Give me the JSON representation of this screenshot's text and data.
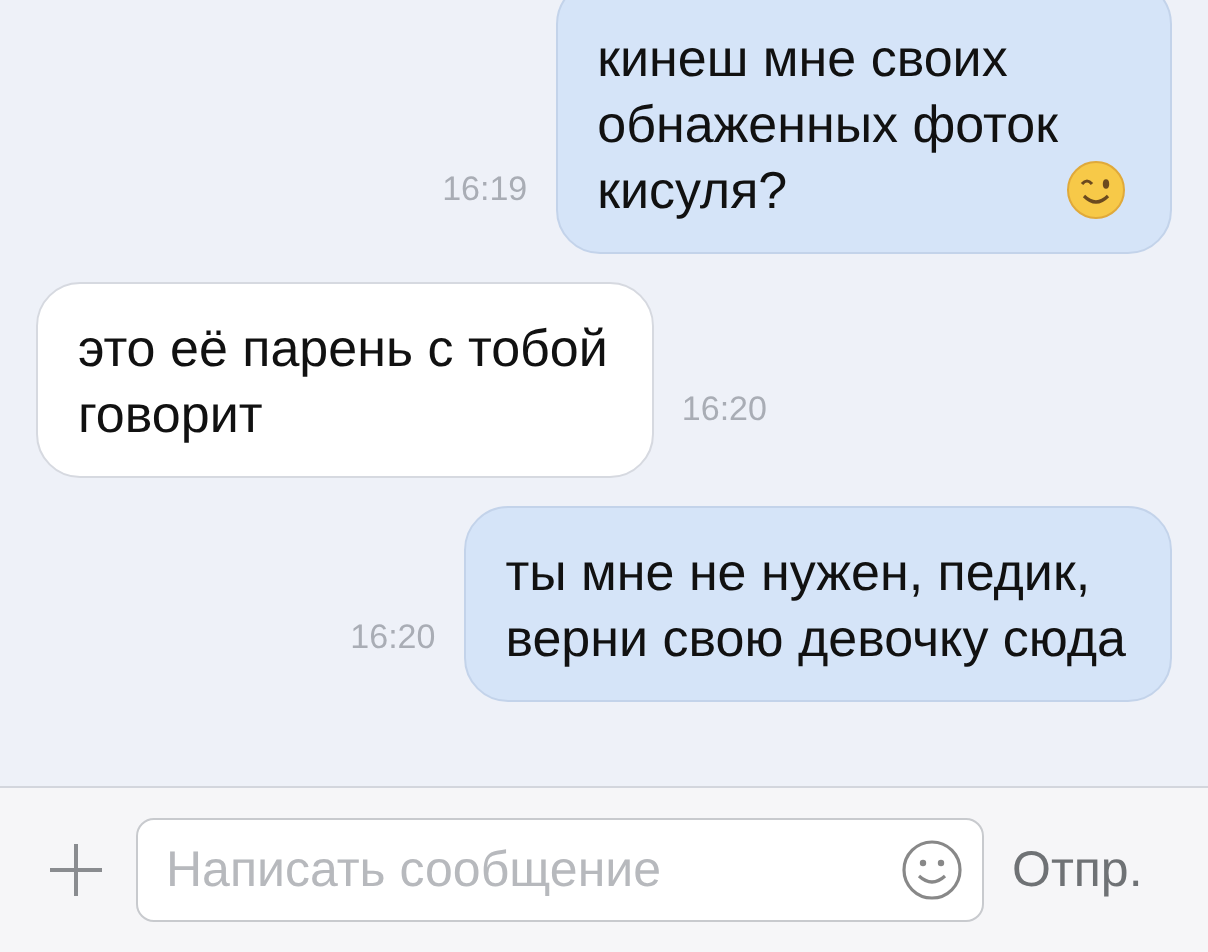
{
  "messages": [
    {
      "kind": "outgoing",
      "text": "кинеш мне своих\nобнаженных фоток\nкисуля?",
      "time": "16:19",
      "has_emoji": true
    },
    {
      "kind": "incoming",
      "text": "это её парень с тобой\nговорит",
      "time": "16:20"
    },
    {
      "kind": "outgoing",
      "text": "ты мне не нужен, педик,\nверни свою девочку сюда",
      "time": "16:20"
    }
  ],
  "composer": {
    "placeholder": "Написать сообщение",
    "send": "Отпр."
  }
}
